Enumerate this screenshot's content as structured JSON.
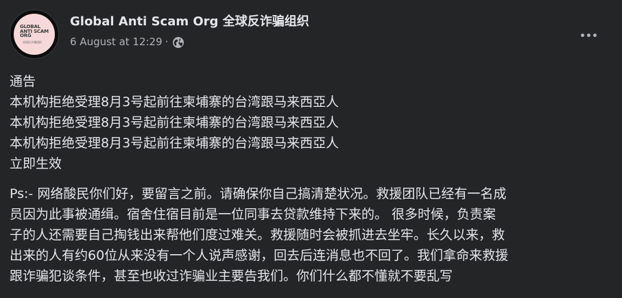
{
  "post": {
    "page_name": "Global Anti Scam Org 全球反诈骗组织",
    "timestamp": "6 August at 12:29",
    "separator": "·",
    "avatar": {
      "logo_text": "GLOBAL\nANTI SCAM\nORG",
      "logo_subtext": "全球反诈骗组织"
    },
    "audience_icon": "globe-icon",
    "more_icon": "more-options-icon",
    "body_lines": [
      "通告",
      "本机构拒绝受理8月3号起前往柬埔寨的台湾跟马来西亞人",
      "本机构拒绝受理8月3号起前往柬埔寨的台湾跟马来西亞人",
      "本机构拒绝受理8月3号起前往柬埔寨的台湾跟马来西亞人",
      "立即生效"
    ],
    "ps_lines": [
      "Ps:- 网络酸民你们好，要留言之前。请确保你自己搞清楚状况。救援团队已经有一名成",
      "员因为此事被通缉。宿舍住宿目前是一位同事去贷款维持下来的。 很多时候，负责案",
      "子的人还需要自己掏钱出来帮他们度过难关。救援随时会被抓进去坐牢。长久以来，救",
      "出来的人有约60位从来没有一个人说声感谢，回去后连消息也不回了。我们拿命来救援",
      "跟诈骗犯谈条件，甚至也收过诈骗业主要告我们。你们什么都不懂就不要乱写"
    ]
  },
  "colors": {
    "background": "#242526",
    "primary_text": "#e4e6eb",
    "secondary_text": "#b0b3b8"
  }
}
